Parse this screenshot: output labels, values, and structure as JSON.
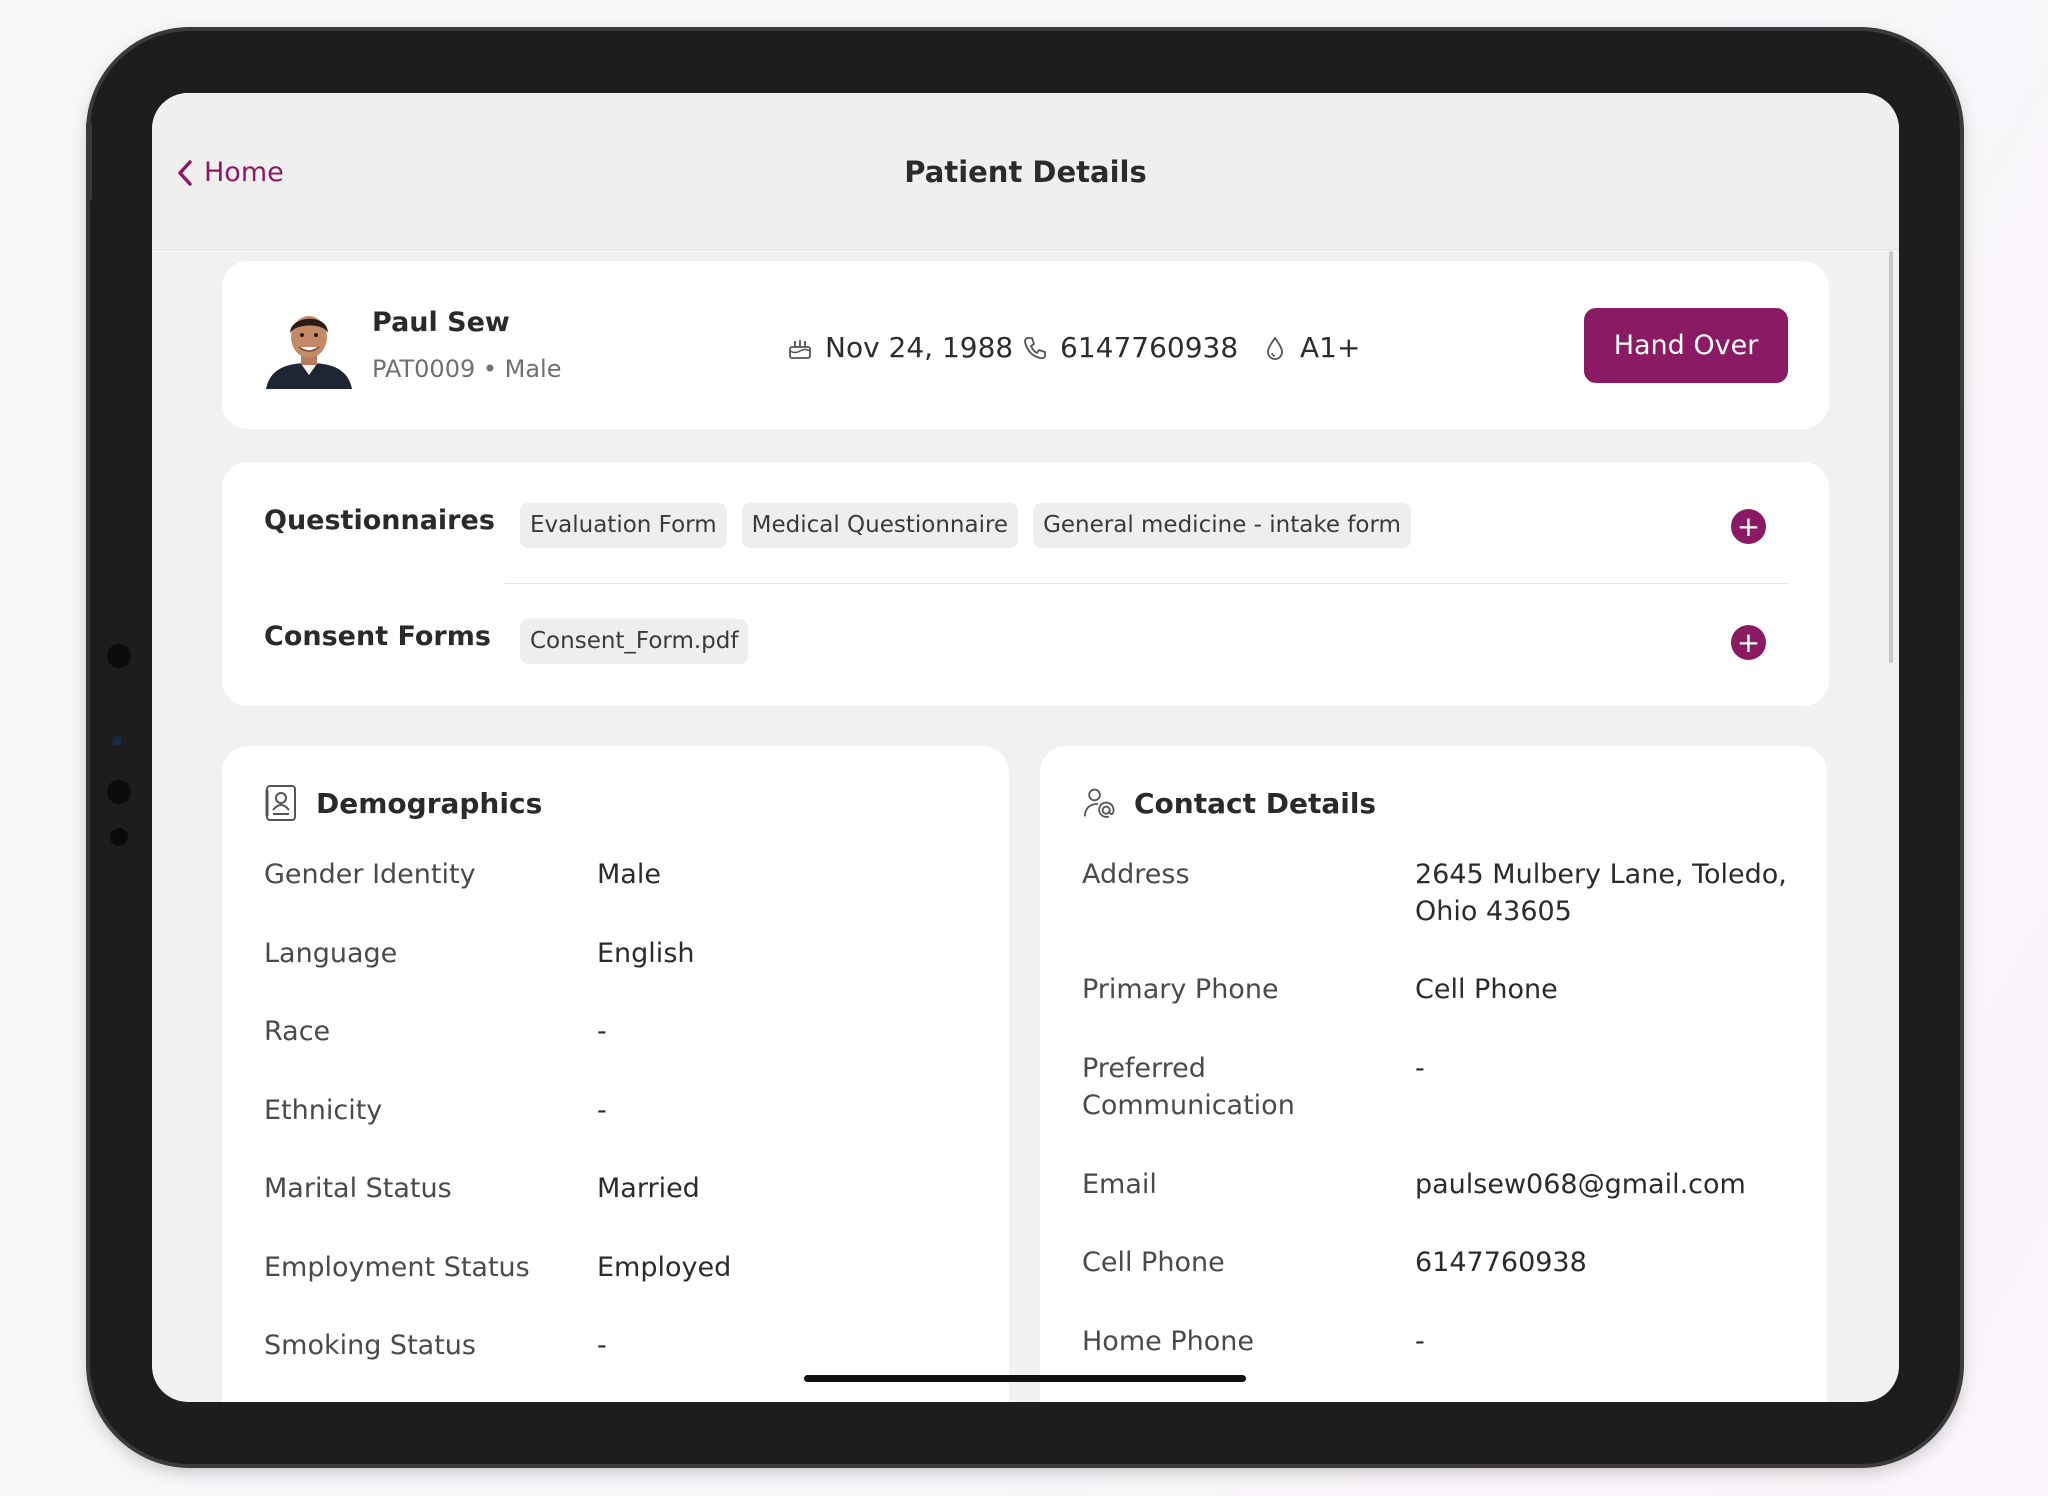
{
  "nav": {
    "back_label": "Home",
    "title": "Patient Details"
  },
  "patient": {
    "name": "Paul Sew",
    "id": "PAT0009",
    "gender": "Male",
    "meta": "PAT0009 • Male",
    "dob": "Nov 24, 1988",
    "phone": "6147760938",
    "blood_group": "A1+",
    "hand_over_label": "Hand Over"
  },
  "forms": {
    "questionnaires_label": "Questionnaires",
    "questionnaires": [
      "Evaluation Form",
      "Medical Questionnaire",
      "General medicine - intake form"
    ],
    "consent_label": "Consent Forms",
    "consent_forms": [
      "Consent_Form.pdf"
    ]
  },
  "demographics": {
    "title": "Demographics",
    "rows": [
      {
        "label": "Gender Identity",
        "value": "Male"
      },
      {
        "label": "Language",
        "value": "English"
      },
      {
        "label": "Race",
        "value": "-"
      },
      {
        "label": "Ethnicity",
        "value": "-"
      },
      {
        "label": "Marital Status",
        "value": "Married"
      },
      {
        "label": "Employment Status",
        "value": "Employed"
      },
      {
        "label": "Smoking Status",
        "value": "-"
      }
    ]
  },
  "contact": {
    "title": "Contact Details",
    "rows": [
      {
        "label": "Address",
        "value": "2645 Mulbery Lane, Toledo, Ohio 43605"
      },
      {
        "label": "Primary Phone",
        "value": "Cell Phone"
      },
      {
        "label": "Preferred Communication",
        "value": "-"
      },
      {
        "label": "Email",
        "value": "paulsew068@gmail.com"
      },
      {
        "label": "Cell Phone",
        "value": "6147760938"
      },
      {
        "label": "Home Phone",
        "value": "-"
      }
    ]
  },
  "icons": {
    "back": "chevron-left-icon",
    "dob": "birthday-cake-icon",
    "phone": "phone-icon",
    "blood": "blood-drop-icon",
    "add": "plus-icon",
    "demographics": "contact-card-icon",
    "contact": "person-at-icon"
  },
  "colors": {
    "accent": "#8a1a63"
  }
}
